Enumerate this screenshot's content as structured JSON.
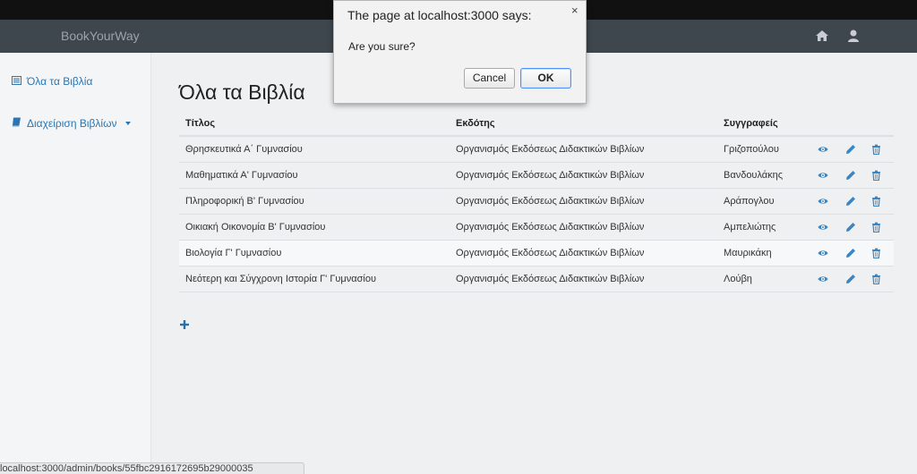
{
  "navbar": {
    "brand": "BookYourWay",
    "icons": [
      "home-icon",
      "user-icon"
    ]
  },
  "sidebar": {
    "items": [
      {
        "label": "Όλα τα Βιβλία",
        "icon": "list-icon"
      },
      {
        "label": "Διαχείριση Βιβλίων",
        "icon": "book-icon",
        "dropdown": true
      }
    ]
  },
  "main": {
    "title": "Όλα τα Βιβλία",
    "table": {
      "headers": [
        "Τίτλος",
        "Εκδότης",
        "Συγγραφείς"
      ],
      "rows": [
        {
          "title": "Θρησκευτικά Α΄ Γυμνασίου",
          "publisher": "Οργανισμός Εκδόσεως Διδακτικών Βιβλίων",
          "author": "Γριζοπούλου"
        },
        {
          "title": "Μαθηματικά Α' Γυμνασίου",
          "publisher": "Οργανισμός Εκδόσεως Διδακτικών Βιβλίων",
          "author": "Βανδουλάκης"
        },
        {
          "title": "Πληροφορική Β' Γυμνασίου",
          "publisher": "Οργανισμός Εκδόσεως Διδακτικών Βιβλίων",
          "author": "Αράπογλου"
        },
        {
          "title": "Οικιακή Οικονομία Β' Γυμνασίου",
          "publisher": "Οργανισμός Εκδόσεως Διδακτικών Βιβλίων",
          "author": "Αμπελιώτης"
        },
        {
          "title": "Βιολογία Γ' Γυμνασίου",
          "publisher": "Οργανισμός Εκδόσεως Διδακτικών Βιβλίων",
          "author": "Μαυρικάκη"
        },
        {
          "title": "Νεότερη και Σύγχρονη Ιστορία Γ' Γυμνασίου",
          "publisher": "Οργανισμός Εκδόσεως Διδακτικών Βιβλίων",
          "author": "Λούβη"
        }
      ],
      "row_actions": [
        "eye-icon",
        "pencil-icon",
        "trash-icon"
      ]
    },
    "add_icon": "plus-icon"
  },
  "dialog": {
    "title": "The page at localhost:3000 says:",
    "message": "Are you sure?",
    "cancel_label": "Cancel",
    "ok_label": "OK",
    "close_glyph": "×"
  },
  "statusbar": {
    "url": "localhost:3000/admin/books/55fbc2916172695b29000035"
  },
  "colors": {
    "navbar": "#3e464e",
    "link": "#2a76b4",
    "sidebar": "#f4f5f6",
    "main_bg": "#eef0f2"
  }
}
